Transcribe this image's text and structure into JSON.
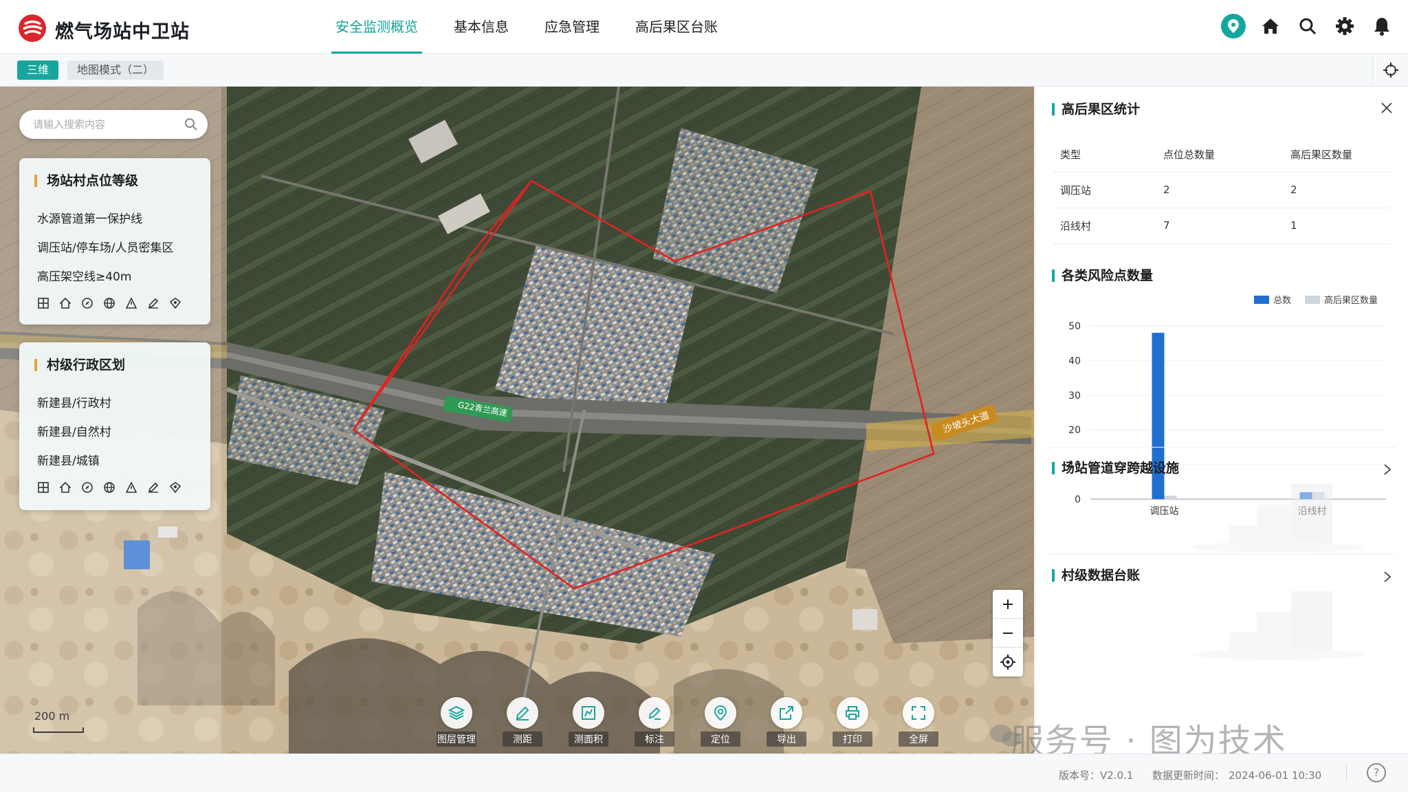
{
  "header": {
    "title": "燃气场站中卫站",
    "nav": [
      {
        "label": "安全监测概览",
        "active": true
      },
      {
        "label": "基本信息",
        "active": false
      },
      {
        "label": "应急管理",
        "active": false
      },
      {
        "label": "高后果区台账",
        "active": false
      }
    ],
    "icons": [
      "location-icon",
      "home-icon",
      "search-icon",
      "gear-icon",
      "bell-icon"
    ]
  },
  "subbar": {
    "mode_3d": "三维",
    "mode_map": "地图模式（二）"
  },
  "search": {
    "placeholder": "请输入搜索内容"
  },
  "left_panels": [
    {
      "title": "场站村点位等级",
      "items": [
        "水源管道第一保护线",
        "调压站/停车场/人员密集区",
        "高压架空线≥40m"
      ]
    },
    {
      "title": "村级行政区划",
      "items": [
        "新建县/行政村",
        "新建县/自然村",
        "新建县/城镇"
      ]
    }
  ],
  "map": {
    "road_labels": [
      "G22青兰高速",
      "沙坡头大道"
    ],
    "scale": "200 m"
  },
  "toolbar": [
    "图层管理",
    "测距",
    "测面积",
    "标注",
    "定位",
    "导出",
    "打印",
    "全屏"
  ],
  "right_panel": {
    "stats": {
      "title": "高后果区统计",
      "columns": [
        "类型",
        "点位总数量",
        "高后果区数量"
      ],
      "rows": [
        [
          "调压站",
          "2",
          "2"
        ],
        [
          "沿线村",
          "7",
          "1"
        ]
      ]
    },
    "risk_title": "各类风险点数量",
    "crossing_title": "场站管道穿跨越设施",
    "ledger_title": "村级数据台账"
  },
  "chart_data": {
    "type": "bar",
    "categories": [
      "调压站",
      "沿线村"
    ],
    "series": [
      {
        "name": "总数",
        "values": [
          48,
          2
        ],
        "color": "#1f6fd1"
      },
      {
        "name": "高后果区数量",
        "values": [
          1,
          2
        ],
        "color": "#cfd6df"
      }
    ],
    "ylim": [
      0,
      50
    ],
    "yticks": [
      0,
      10,
      20,
      30,
      40,
      50
    ],
    "legend": "top-right"
  },
  "footer": {
    "version": "版本号：V2.0.1",
    "update_label": "数据更新时间：",
    "update_time": "2024-06-01 10:30"
  },
  "watermark": "服务号 · 图为技术",
  "colors": {
    "accent": "#17a69d",
    "orange_accent": "#e9a23b",
    "boundary": "#e32222"
  }
}
